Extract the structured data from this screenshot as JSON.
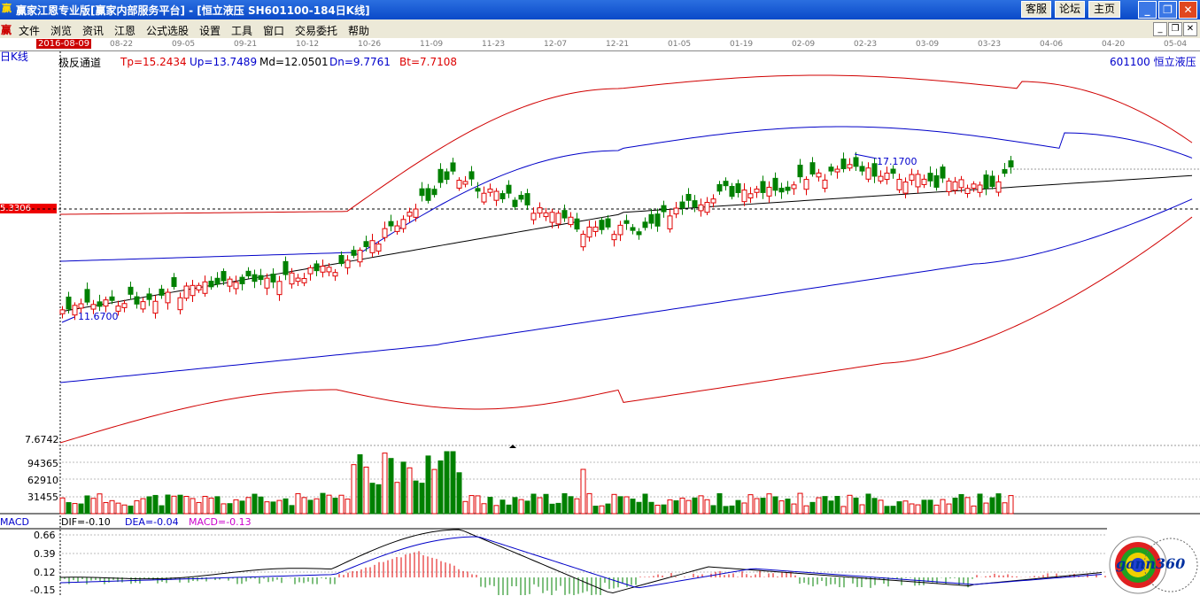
{
  "window": {
    "app_icon": "赢",
    "title": "赢家江恩专业版[赢家内部服务平台] - [恒立液压   SH601100-184日K线]",
    "buttons": [
      "客服",
      "论坛",
      "主页"
    ],
    "controls": [
      "_",
      "❐",
      "✕"
    ]
  },
  "menu": {
    "icon": "赢",
    "items": [
      "文件",
      "浏览",
      "资讯",
      "江恩",
      "公式选股",
      "设置",
      "工具",
      "窗口",
      "交易委托",
      "帮助"
    ]
  },
  "dates": {
    "selected": "2016-08-09",
    "ticks": [
      "08-22",
      "09-05",
      "09-21",
      "10-12",
      "10-26",
      "11-09",
      "11-23",
      "12-07",
      "12-21",
      "01-05",
      "01-19",
      "02-09",
      "02-23",
      "03-09",
      "03-23",
      "04-06",
      "04-20",
      "05-04"
    ]
  },
  "chart_header": {
    "period_label": "日K线",
    "indicator_name": "极反通道",
    "tp": "Tp=15.2434",
    "up": "Up=13.7489",
    "md": "Md=12.0501",
    "dn": "Dn=9.7761",
    "bt": "Bt=7.7108",
    "stock": "601100  恒立液压"
  },
  "price_axis": {
    "crosshair_value": "5.3306",
    "bottom_value": "7.6742",
    "high_label": "17.1700",
    "low_label": "11.6700"
  },
  "volume_axis": [
    "94365",
    "62910",
    "31455"
  ],
  "macd": {
    "title": "MACD",
    "dif": "DIF=-0.10",
    "dea": "DEA=-0.04",
    "macd": "MACD=-0.13",
    "axis": [
      "0.66",
      "0.39",
      "0.12",
      "-0.15"
    ]
  },
  "colors": {
    "up": "#e00000",
    "down": "#008000",
    "band_outer": "#d00000",
    "band_inner": "#0000c8",
    "mid": "#000000",
    "macd_dea": "#0000c8"
  },
  "logo": {
    "text": "gann360",
    "icon": "gann-wheel-icon"
  }
}
